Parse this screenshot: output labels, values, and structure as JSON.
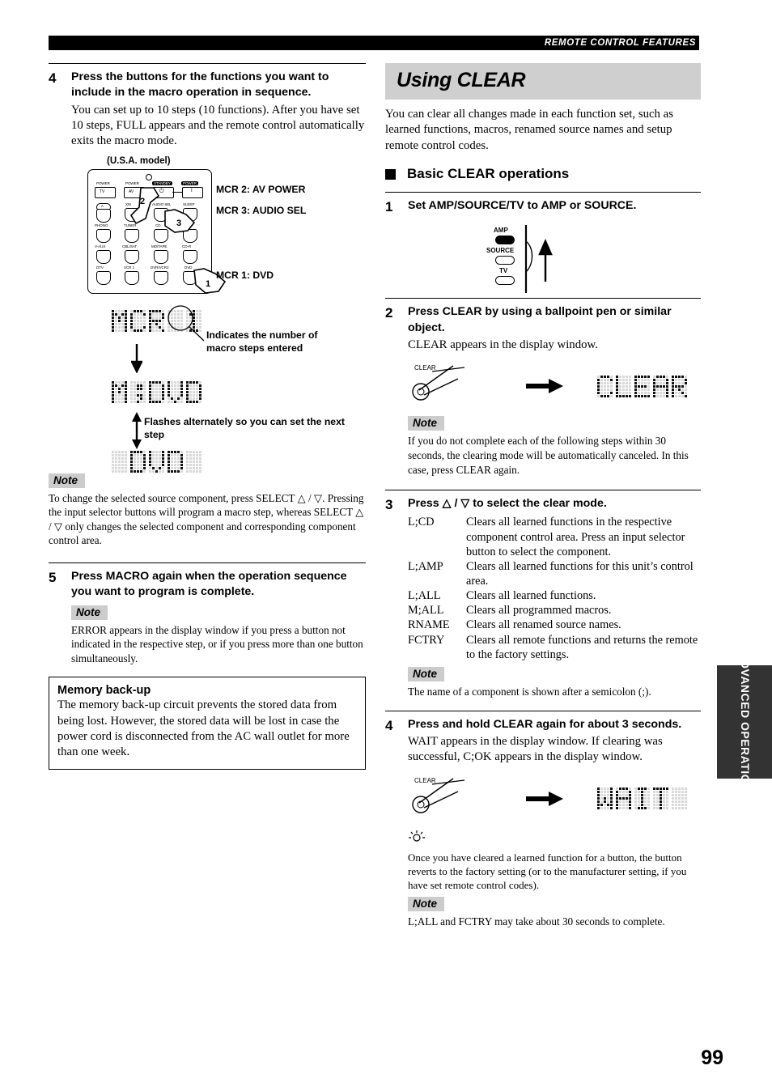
{
  "header": {
    "running_head": "REMOTE CONTROL FEATURES"
  },
  "page_number": "99",
  "side_tab": {
    "label": "ADVANCED OPERATION"
  },
  "left": {
    "step4": {
      "number": "4",
      "heading": "Press the buttons for the functions you want to include in the macro operation in sequence.",
      "body": "You can set up to 10 steps (10 functions). After you have set 10 steps, FULL appears and the remote control automatically exits the macro mode."
    },
    "figure_remote": {
      "caption": "(U.S.A. model)",
      "row1": [
        {
          "top": "POWER",
          "key": "TV"
        },
        {
          "top": "POWER",
          "key": "AV"
        },
        {
          "top": "STANDBY",
          "key": "standby-glyph"
        },
        {
          "top": "POWER",
          "key": "I"
        }
      ],
      "row2": [
        "A",
        "XM",
        "AUDIO SEL",
        "SLEEP"
      ],
      "row3": [
        "PHONO",
        "TUNER",
        "CD",
        "6 CH IN"
      ],
      "row4": [
        "V-AUX",
        "CBL/SAT",
        "MD/TAPE",
        "CD-R"
      ],
      "row5": [
        "DTV",
        "VCR 1",
        "DVR/VCR2",
        "DVD"
      ],
      "markers": [
        "1",
        "2",
        "3"
      ],
      "labels": [
        "MCR 2: AV POWER",
        "MCR 3: AUDIO SEL",
        "MCR 1: DVD"
      ]
    },
    "figure_display": {
      "lcd1": "MCR 1",
      "lcd2": "M;DVD",
      "lcd3": " DVD ",
      "callout1": "Indicates the number of macro steps entered",
      "callout2": "Flashes alternately so you can set the next step"
    },
    "note1": {
      "tag": "Note",
      "body_a": "To change the selected source component, press SELECT ",
      "body_b": " / ",
      "body_c": ". Pressing the input selector buttons will program a macro step, whereas SELECT ",
      "body_d": " / ",
      "body_e": " only changes the selected component and corresponding component control area."
    },
    "step5": {
      "number": "5",
      "heading": "Press MACRO again when the operation sequence you want to program is complete.",
      "note_tag": "Note",
      "note_body": "ERROR appears in the display window if you press a button not indicated in the respective step, or if you press more than one button simultaneously."
    },
    "memory_box": {
      "title": "Memory back-up",
      "body": "The memory back-up circuit prevents the stored data from being lost. However, the stored data will be lost in case the power cord is disconnected from the AC wall outlet for more than one week."
    }
  },
  "right": {
    "section_title": "Using CLEAR",
    "intro": "You can clear all changes made in each function set, such as learned functions, macros, renamed source names and setup remote control codes.",
    "subsection": "Basic CLEAR operations",
    "step1": {
      "number": "1",
      "heading": "Set AMP/SOURCE/TV to AMP or SOURCE.",
      "switch_labels": [
        "AMP",
        "SOURCE",
        "TV"
      ]
    },
    "step2": {
      "number": "2",
      "heading": "Press CLEAR by using a ballpoint pen or similar object.",
      "body": "CLEAR appears in the display window.",
      "button_label": "CLEAR",
      "lcd": "CLEAR",
      "note_tag": "Note",
      "note_body": "If you do not complete each of the following steps within 30 seconds, the clearing mode will be automatically canceled. In this case, press CLEAR again."
    },
    "step3": {
      "number": "3",
      "heading_a": "Press ",
      "heading_b": " / ",
      "heading_c": " to select the clear mode.",
      "modes": [
        {
          "term": "L;CD",
          "desc": "Clears all learned functions in the respective component control area. Press an input selector button to select the component."
        },
        {
          "term": "L;AMP",
          "desc": "Clears all learned functions for this unit’s control area."
        },
        {
          "term": "L;ALL",
          "desc": "Clears all learned functions."
        },
        {
          "term": "M;ALL",
          "desc": "Clears all programmed macros."
        },
        {
          "term": "RNAME",
          "desc": "Clears all renamed source names."
        },
        {
          "term": "FCTRY",
          "desc": "Clears all remote functions and returns the remote to the factory settings."
        }
      ],
      "note_tag": "Note",
      "note_body": "The name of a component is shown after a semicolon (;)."
    },
    "step4": {
      "number": "4",
      "heading": "Press and hold CLEAR again for about 3 seconds.",
      "body": "WAIT appears in the display window. If clearing was successful, C;OK appears in the display window.",
      "button_label": "CLEAR",
      "lcd": "WAIT ",
      "tip_body": "Once you have cleared a learned function for a button, the button reverts to the factory setting (or to the manufacturer setting, if you have set remote control codes).",
      "note_tag": "Note",
      "note_body": "L;ALL and FCTRY may take about 30 seconds to complete."
    }
  },
  "lcd_font": {
    "M": [
      "10001",
      "11011",
      "10101",
      "10101",
      "10001",
      "10001",
      "10001"
    ],
    "C": [
      "01110",
      "10001",
      "10000",
      "10000",
      "10000",
      "10001",
      "01110"
    ],
    "R": [
      "11110",
      "10001",
      "10001",
      "11110",
      "10100",
      "10010",
      "10001"
    ],
    "1": [
      "00100",
      "01100",
      "00100",
      "00100",
      "00100",
      "00100",
      "01110"
    ],
    "D": [
      "11110",
      "10001",
      "10001",
      "10001",
      "10001",
      "10001",
      "11110"
    ],
    "V": [
      "10001",
      "10001",
      "10001",
      "10001",
      "10001",
      "01010",
      "00100"
    ],
    ";": [
      "00000",
      "00110",
      "00110",
      "00000",
      "00110",
      "00010",
      "00100"
    ],
    "L": [
      "10000",
      "10000",
      "10000",
      "10000",
      "10000",
      "10000",
      "11111"
    ],
    "E": [
      "11111",
      "10000",
      "10000",
      "11110",
      "10000",
      "10000",
      "11111"
    ],
    "A": [
      "01110",
      "10001",
      "10001",
      "11111",
      "10001",
      "10001",
      "10001"
    ],
    "W": [
      "10001",
      "10001",
      "10001",
      "10101",
      "10101",
      "11011",
      "10001"
    ],
    "I": [
      "01110",
      "00100",
      "00100",
      "00100",
      "00100",
      "00100",
      "01110"
    ],
    "T": [
      "11111",
      "00100",
      "00100",
      "00100",
      "00100",
      "00100",
      "00100"
    ],
    " ": [
      "00000",
      "00000",
      "00000",
      "00000",
      "00000",
      "00000",
      "00000"
    ]
  }
}
